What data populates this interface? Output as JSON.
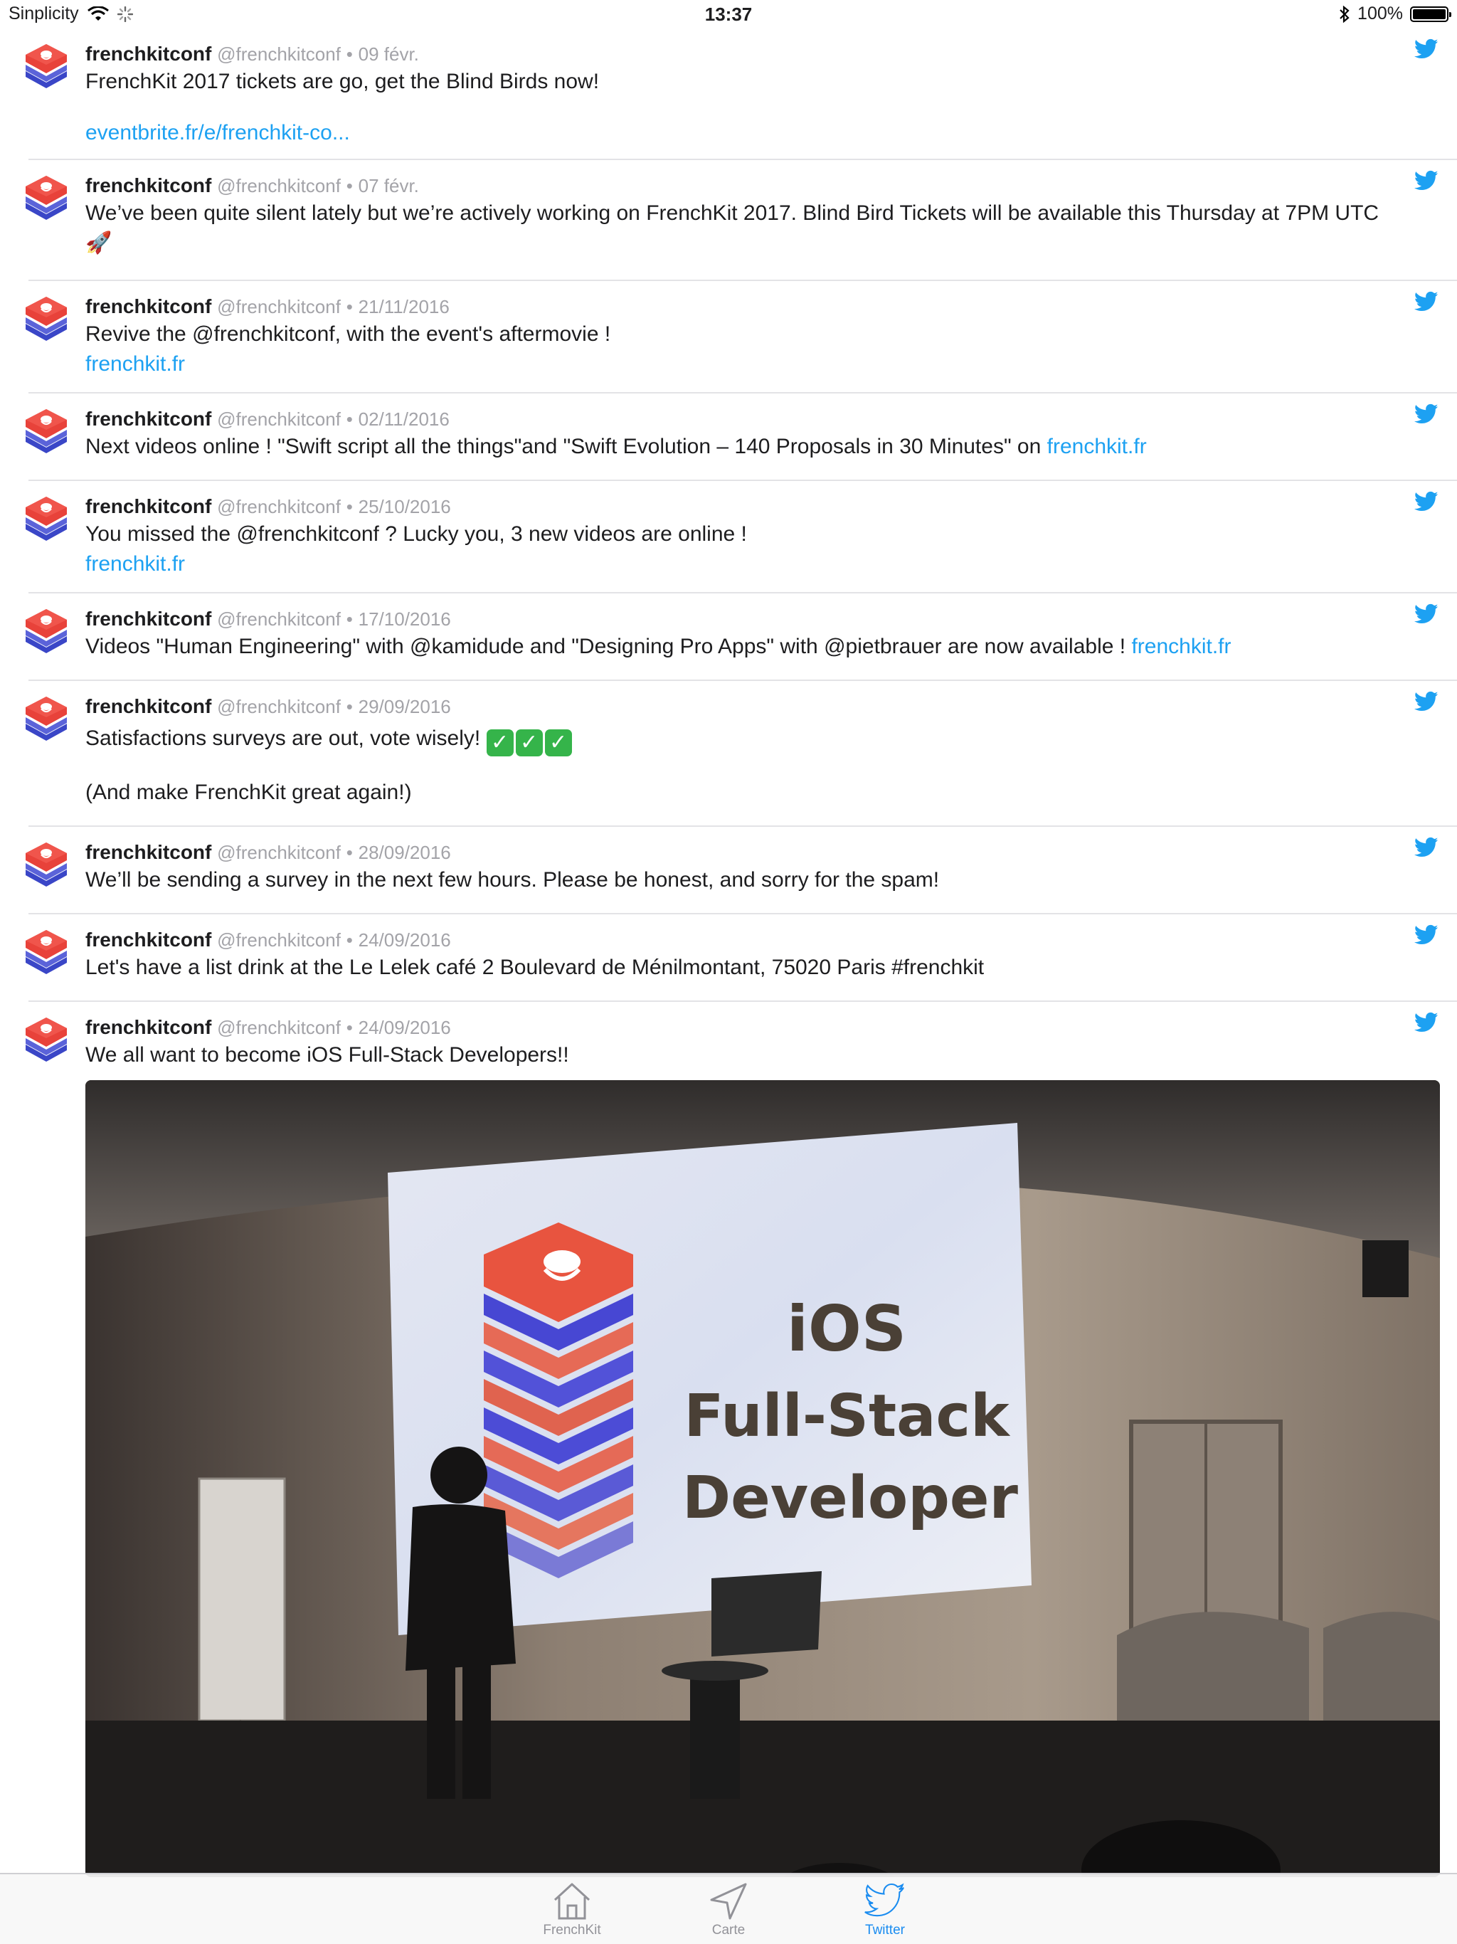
{
  "status_bar": {
    "carrier": "Sinplicity",
    "time": "13:37",
    "battery_text": "100%"
  },
  "colors": {
    "accent": "#1da1f2",
    "tab_inactive": "#929298",
    "divider": "#e3e3e6"
  },
  "tweets": [
    {
      "name": "frenchkitconf",
      "handle": "@frenchkitconf",
      "sep": "•",
      "date": "09 févr.",
      "line1": "FrenchKit 2017 tickets are go, get the Blind Birds now!",
      "link": "eventbrite.fr/e/frenchkit-co..."
    },
    {
      "name": "frenchkitconf",
      "handle": "@frenchkitconf",
      "sep": "•",
      "date": "07 févr.",
      "line1": "We’ve been quite silent lately but we’re actively working on FrenchKit 2017. Blind Bird Tickets will be available this Thursday at 7PM UTC",
      "line2": "🚀"
    },
    {
      "name": "frenchkitconf",
      "handle": "@frenchkitconf",
      "sep": "•",
      "date": "21/11/2016",
      "line1": "Revive the @frenchkitconf, with the event's aftermovie !",
      "link": "frenchkit.fr"
    },
    {
      "name": "frenchkitconf",
      "handle": "@frenchkitconf",
      "sep": "•",
      "date": "02/11/2016",
      "line1": "Next videos online ! \"Swift script all the things\"and \"Swift Evolution – 140 Proposals in 30 Minutes\" on ",
      "link": "frenchkit.fr"
    },
    {
      "name": "frenchkitconf",
      "handle": "@frenchkitconf",
      "sep": "•",
      "date": "25/10/2016",
      "line1": "You missed the @frenchkitconf ? Lucky you, 3 new videos are online !",
      "link": "frenchkit.fr"
    },
    {
      "name": "frenchkitconf",
      "handle": "@frenchkitconf",
      "sep": "•",
      "date": "17/10/2016",
      "line1": "Videos \"Human Engineering\" with @kamidude and \"Designing Pro Apps\" with @pietbrauer are now available ! ",
      "link": "frenchkit.fr"
    },
    {
      "name": "frenchkitconf",
      "handle": "@frenchkitconf",
      "sep": "•",
      "date": "29/09/2016",
      "line1": "Satisfactions surveys are out, vote wisely! ",
      "check": "✓",
      "line2": "(And make FrenchKit great again!)"
    },
    {
      "name": "frenchkitconf",
      "handle": "@frenchkitconf",
      "sep": "•",
      "date": "28/09/2016",
      "line1": "We’ll be sending a survey in the next few hours. Please be honest, and sorry for the spam!"
    },
    {
      "name": "frenchkitconf",
      "handle": "@frenchkitconf",
      "sep": "•",
      "date": "24/09/2016",
      "line1": "Let's have a list drink at the Le Lelek café 2 Boulevard de Ménilmontant, 75020 Paris #frenchkit"
    },
    {
      "name": "frenchkitconf",
      "handle": "@frenchkitconf",
      "sep": "•",
      "date": "24/09/2016",
      "line1": "We all want to become iOS Full-Stack Developers!!"
    }
  ],
  "photo": {
    "slide_line1": "iOS",
    "slide_line2": "Full-Stack",
    "slide_line3": "Developer"
  },
  "tabs": [
    {
      "label": "FrenchKit",
      "icon": "home-icon",
      "active": false
    },
    {
      "label": "Carte",
      "icon": "location-arrow-icon",
      "active": false
    },
    {
      "label": "Twitter",
      "icon": "twitter-bird-icon",
      "active": true
    }
  ]
}
